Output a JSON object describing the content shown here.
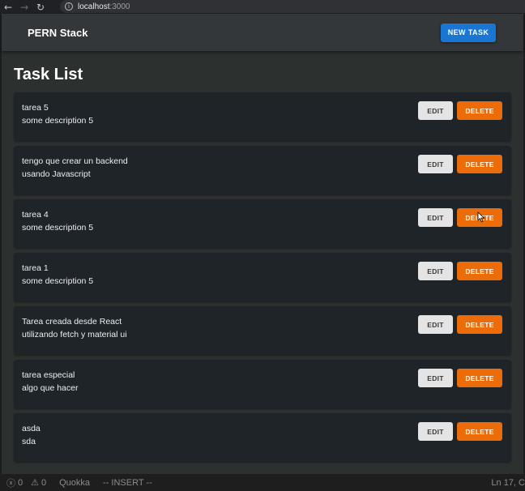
{
  "browser": {
    "back_glyph": "←",
    "forward_glyph": "→",
    "reload_glyph": "↻",
    "info_glyph": "i",
    "url_host": "localhost",
    "url_port": ":3000"
  },
  "appbar": {
    "title": "PERN Stack",
    "new_task_label": "NEW TASK"
  },
  "page": {
    "title": "Task List"
  },
  "tasks": [
    {
      "title": "tarea 5",
      "description": "some description 5"
    },
    {
      "title": "tengo que crear un backend",
      "description": "usando Javascript"
    },
    {
      "title": "tarea 4",
      "description": "some description 5"
    },
    {
      "title": "tarea 1",
      "description": "some description 5"
    },
    {
      "title": "Tarea creada desde React",
      "description": "utilizando fetch y material ui"
    },
    {
      "title": "tarea especial",
      "description": "algo que hacer"
    },
    {
      "title": "asda",
      "description": "sda"
    }
  ],
  "actions": {
    "edit_label": "EDIT",
    "delete_label": "DELETE"
  },
  "statusbar": {
    "errors_icon": "ⓧ",
    "errors": "0",
    "warnings_icon": "⚠",
    "warnings": "0",
    "quokka": "Quokka",
    "mode": "-- INSERT --",
    "position": "Ln 17, C"
  },
  "colors": {
    "primary": "#1976d2",
    "delete": "#ed6c0a",
    "card": "#1e2428"
  },
  "icons": [
    "back-arrow-icon",
    "forward-arrow-icon",
    "reload-icon",
    "info-icon",
    "cursor-icon",
    "error-icon",
    "warning-icon"
  ]
}
